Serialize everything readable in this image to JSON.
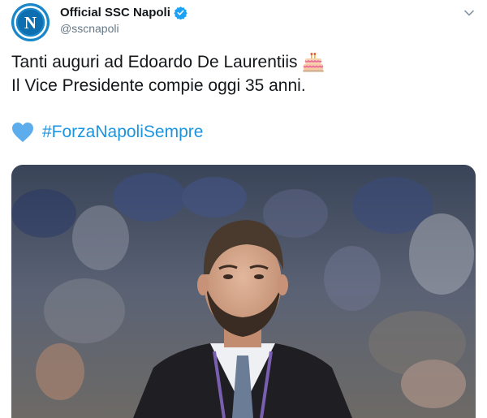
{
  "account": {
    "display_name": "Official SSC Napoli",
    "handle": "@sscnapoli",
    "avatar_letter": "N",
    "verified": true
  },
  "tweet": {
    "line1": "Tanti auguri ad Edoardo De Laurentiis",
    "line2": "Il Vice Presidente compie oggi 35 anni.",
    "hashtag": "#ForzaNapoliSempre"
  },
  "icons": {
    "verified": "verified-badge-icon",
    "caret": "chevron-down-icon",
    "cake": "birthday-cake-icon",
    "heart": "blue-heart-icon"
  },
  "colors": {
    "brand_blue": "#1b95e0",
    "avatar_blue": "#1a87c8",
    "text_primary": "#14171a",
    "text_secondary": "#657786"
  }
}
